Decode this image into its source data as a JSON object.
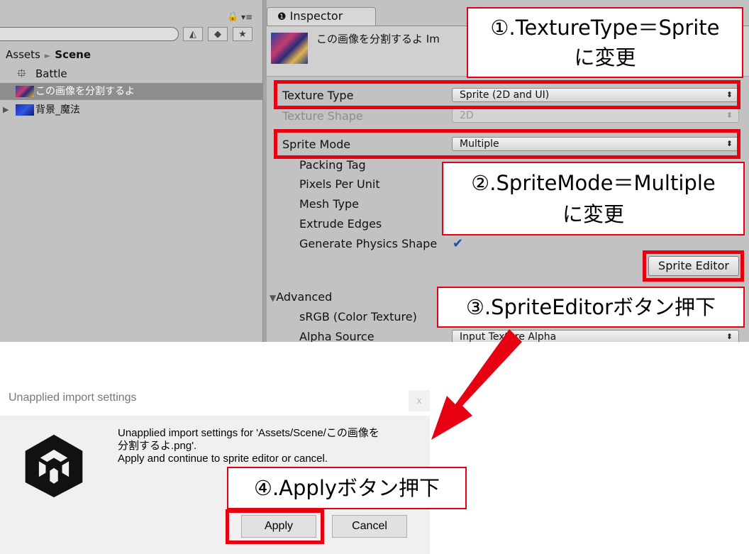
{
  "project": {
    "breadcrumb": [
      "Assets",
      "Scene"
    ],
    "items": [
      {
        "name": "Battle",
        "icon": "unity-scene-icon"
      },
      {
        "name": "この画像を分割するよ",
        "icon": "image-thumbnail"
      },
      {
        "name": "背景_魔法",
        "icon": "image-thumbnail"
      }
    ],
    "toolbar_icons": [
      "filter-by-type-icon",
      "label-icon",
      "favorite-star-icon"
    ]
  },
  "inspector": {
    "tab_label": "Inspector",
    "title": "この画像を分割するよ Im",
    "fields": {
      "texture_type": {
        "label": "Texture Type",
        "value": "Sprite (2D and UI)"
      },
      "texture_shape": {
        "label": "Texture Shape",
        "value": "2D"
      },
      "sprite_mode": {
        "label": "Sprite Mode",
        "value": "Multiple"
      },
      "packing_tag": {
        "label": "Packing Tag"
      },
      "pixels_per_unit": {
        "label": "Pixels Per Unit"
      },
      "mesh_type": {
        "label": "Mesh Type"
      },
      "extrude_edges": {
        "label": "Extrude Edges"
      },
      "generate_physics_shape": {
        "label": "Generate Physics Shape",
        "checked": true
      },
      "advanced": {
        "label": "Advanced"
      },
      "srgb": {
        "label": "sRGB (Color Texture)"
      },
      "alpha_source": {
        "label": "Alpha Source",
        "value": "Input Texture Alpha"
      }
    },
    "sprite_editor_button": "Sprite Editor"
  },
  "dialog": {
    "title": "Unapplied import settings",
    "close_label": "x",
    "message": [
      "Unapplied import settings for 'Assets/Scene/この画像を",
      "分割するよ.png'.",
      "Apply and continue to sprite editor or cancel."
    ],
    "apply_label": "Apply",
    "cancel_label": "Cancel"
  },
  "annotations": {
    "step1": [
      "①.TextureType＝Sprite",
      "に変更"
    ],
    "step2": [
      "②.SpriteMode＝Multiple",
      "に変更"
    ],
    "step3": "③.SpriteEditorボタン押下",
    "step4": "④.Applyボタン押下",
    "highlight_color": "#e60012"
  }
}
